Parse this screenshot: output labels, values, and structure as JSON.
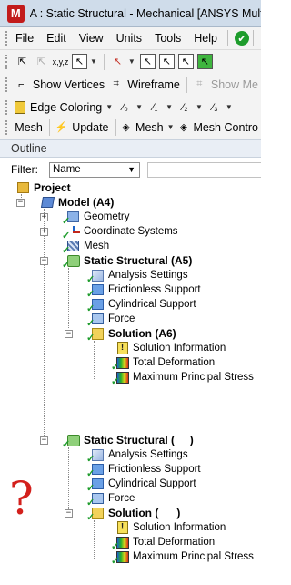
{
  "window": {
    "title": "A : Static Structural - Mechanical [ANSYS Multiph",
    "logo_letter": "M"
  },
  "menubar": {
    "items": [
      "File",
      "Edit",
      "View",
      "Units",
      "Tools",
      "Help"
    ],
    "solve_icon": "solve-check-icon"
  },
  "toolbar3": {
    "show_vertices": "Show Vertices",
    "wireframe": "Wireframe",
    "show_mesh": "Show Me"
  },
  "toolbar4": {
    "edge_coloring": "Edge Coloring"
  },
  "toolbar5": {
    "mesh": "Mesh",
    "update": "Update",
    "mesh_dropdown": "Mesh",
    "mesh_control": "Mesh Contro"
  },
  "outline": {
    "header": "Outline",
    "filter_label": "Filter:",
    "filter_value": "Name"
  },
  "tree": {
    "project": "Project",
    "model": "Model (A4)",
    "geometry": "Geometry",
    "coordinate_systems": "Coordinate Systems",
    "mesh": "Mesh",
    "analysis1": {
      "label": "Static Structural (A5)",
      "analysis_settings": "Analysis Settings",
      "frictionless_support": "Frictionless Support",
      "cylindrical_support": "Cylindrical Support",
      "force": "Force",
      "solution": "Solution (A6)",
      "solution_information": "Solution Information",
      "total_deformation": "Total Deformation",
      "max_principal_stress": "Maximum Principal Stress"
    },
    "analysis2": {
      "label": "Static Structural (     )",
      "analysis_settings": "Analysis Settings",
      "frictionless_support": "Frictionless Support",
      "cylindrical_support": "Cylindrical Support",
      "force": "Force",
      "solution": "Solution (      )",
      "solution_information": "Solution Information",
      "total_deformation": "Total Deformation",
      "max_principal_stress": "Maximum Principal Stress"
    }
  },
  "annotation": {
    "question_mark": "?",
    "color": "#d3201c"
  }
}
